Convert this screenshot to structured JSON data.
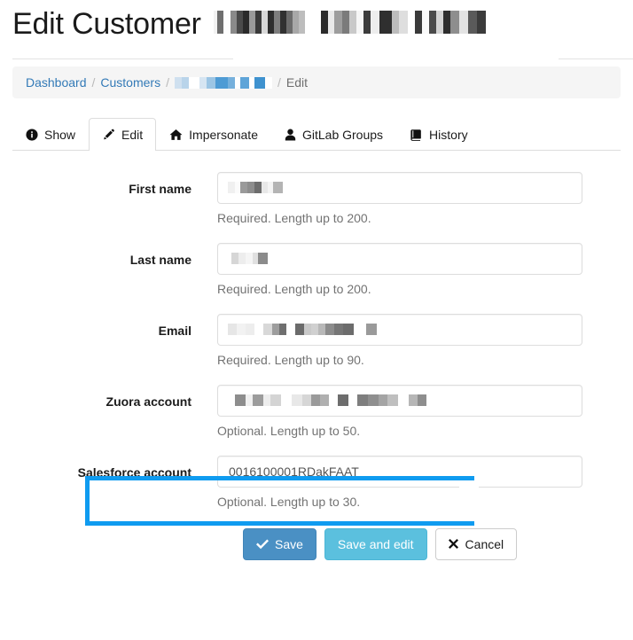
{
  "header": {
    "title": "Edit Customer",
    "redacted_name_1": "redacted-customer-name",
    "redacted_name_2": "redacted-customer-detail"
  },
  "breadcrumb": {
    "items": [
      {
        "label": "Dashboard",
        "type": "link"
      },
      {
        "label": "Customers",
        "type": "link"
      },
      {
        "label": "",
        "type": "redacted-link"
      },
      {
        "label": "Edit",
        "type": "current"
      }
    ],
    "separator": "/"
  },
  "tabs": [
    {
      "label": "Show",
      "icon": "info-circle-icon",
      "active": false
    },
    {
      "label": "Edit",
      "icon": "pencil-icon",
      "active": true
    },
    {
      "label": "Impersonate",
      "icon": "home-icon",
      "active": false
    },
    {
      "label": "GitLab Groups",
      "icon": "user-icon",
      "active": false
    },
    {
      "label": "History",
      "icon": "book-icon",
      "active": false
    }
  ],
  "form": {
    "fields": [
      {
        "label": "First name",
        "value": "",
        "redacted": true,
        "help": "Required. Length up to 200.",
        "name": "first-name"
      },
      {
        "label": "Last name",
        "value": "",
        "redacted": true,
        "help": "Required. Length up to 200.",
        "name": "last-name"
      },
      {
        "label": "Email",
        "value": "",
        "redacted": true,
        "help": "Required. Length up to 90.",
        "name": "email"
      },
      {
        "label": "Zuora account",
        "value": "",
        "redacted": true,
        "help": "Optional. Length up to 50.",
        "name": "zuora-account"
      },
      {
        "label": "Salesforce account",
        "value": "0016100001RDakFAAT",
        "redacted": false,
        "help": "Optional. Length up to 30.",
        "name": "salesforce-account",
        "highlighted": true
      }
    ]
  },
  "buttons": {
    "save": "Save",
    "save_and_edit": "Save and edit",
    "cancel": "Cancel"
  },
  "colors": {
    "link": "#337ab7",
    "primary_button": "#4a90c4",
    "info_button": "#5bc0de",
    "highlight_border": "#0f9bf0",
    "breadcrumb_bg": "#f5f5f5",
    "help_text": "#737373"
  }
}
